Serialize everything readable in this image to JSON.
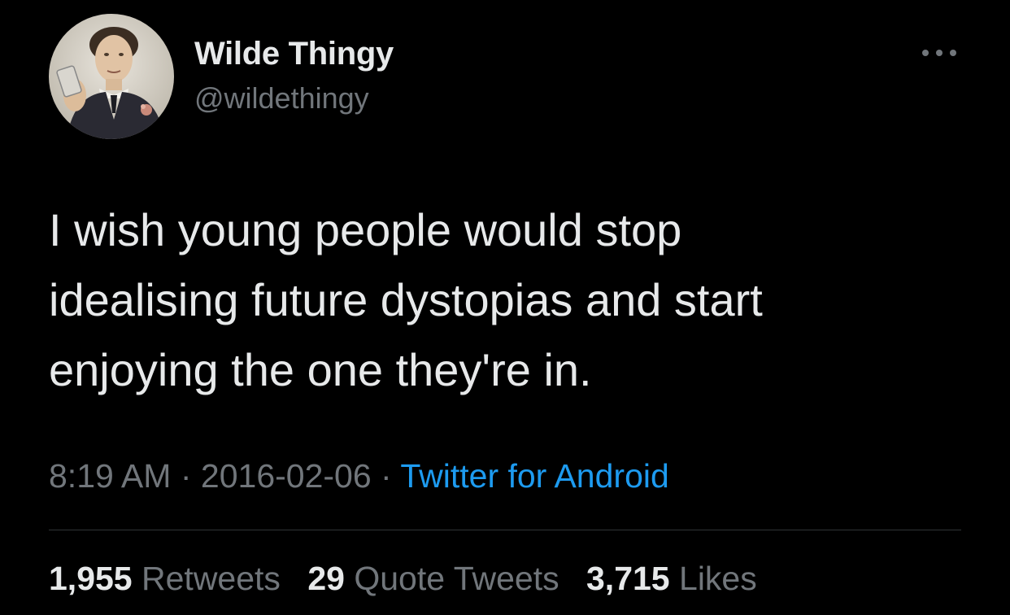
{
  "author": {
    "display_name": "Wilde Thingy",
    "handle": "@wildethingy",
    "avatar_icon": "portrait-avatar"
  },
  "more_icon": "more-options-icon",
  "tweet": {
    "lines": [
      "I wish young people would stop",
      "idealising future dystopias and start",
      "enjoying the one they're in."
    ]
  },
  "meta": {
    "time": "8:19 AM",
    "separator": "·",
    "date": "2016-02-06",
    "source": "Twitter for Android"
  },
  "stats": {
    "retweets": {
      "count": "1,955",
      "label": "Retweets"
    },
    "quotes": {
      "count": "29",
      "label": "Quote Tweets"
    },
    "likes": {
      "count": "3,715",
      "label": "Likes"
    }
  },
  "colors": {
    "background": "#000000",
    "primary_text": "#e7e9ea",
    "secondary_text": "#71767b",
    "link": "#1d9bf0",
    "divider": "#2f3336"
  }
}
